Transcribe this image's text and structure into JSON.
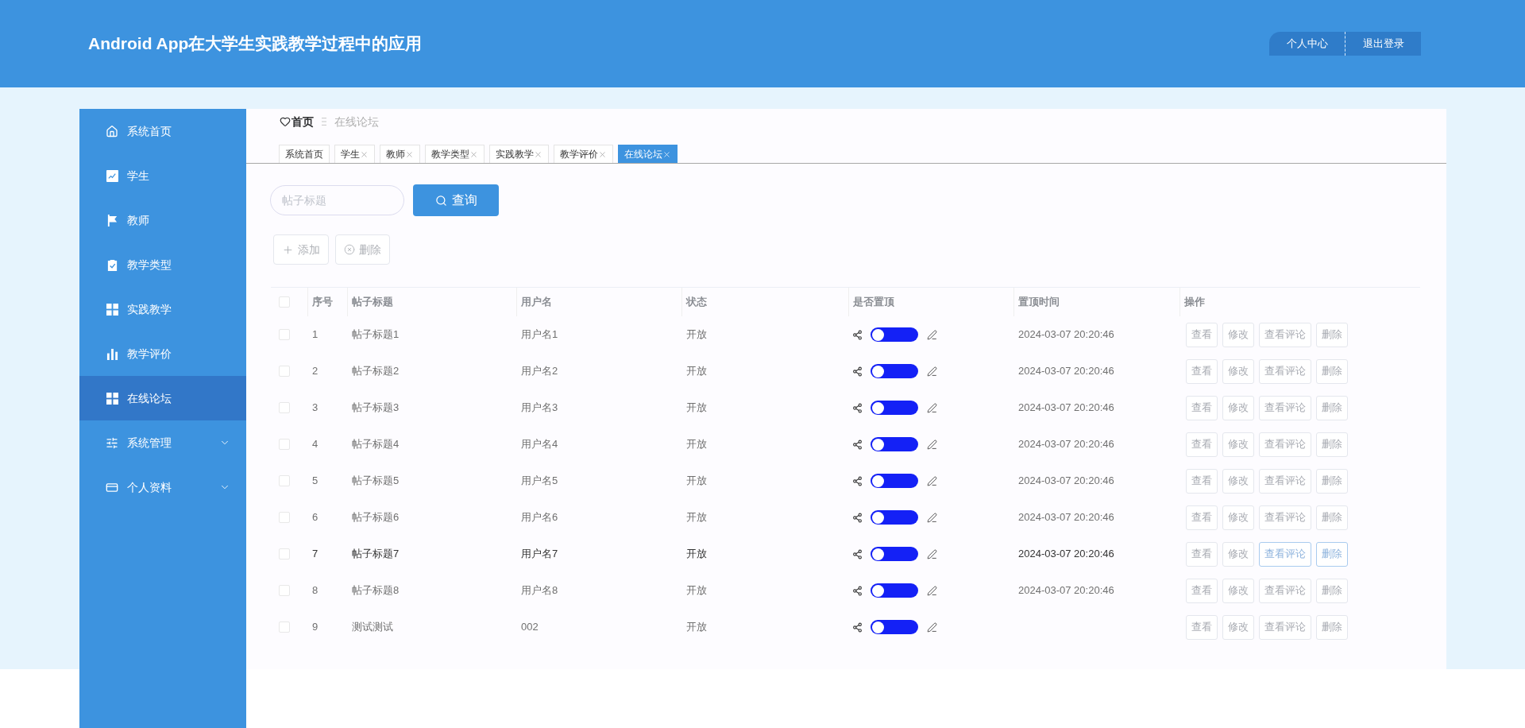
{
  "header": {
    "title": "Android App在大学生实践教学过程中的应用",
    "buttons": [
      "个人中心",
      "退出登录"
    ]
  },
  "sidebar": {
    "items": [
      {
        "label": "系统首页",
        "selected": false,
        "expandable": false
      },
      {
        "label": "学生",
        "selected": false,
        "expandable": false
      },
      {
        "label": "教师",
        "selected": false,
        "expandable": false
      },
      {
        "label": "教学类型",
        "selected": false,
        "expandable": false
      },
      {
        "label": "实践教学",
        "selected": false,
        "expandable": false
      },
      {
        "label": "教学评价",
        "selected": false,
        "expandable": false
      },
      {
        "label": "在线论坛",
        "selected": true,
        "expandable": false
      },
      {
        "label": "系统管理",
        "selected": false,
        "expandable": true
      },
      {
        "label": "个人资料",
        "selected": false,
        "expandable": true
      }
    ]
  },
  "breadcrumb": [
    "首页",
    "在线论坛"
  ],
  "tabs": [
    {
      "label": "系统首页",
      "selected": false,
      "closable": false
    },
    {
      "label": "学生",
      "selected": false,
      "closable": true
    },
    {
      "label": "教师",
      "selected": false,
      "closable": true
    },
    {
      "label": "教学类型",
      "selected": false,
      "closable": true
    },
    {
      "label": "实践教学",
      "selected": false,
      "closable": true
    },
    {
      "label": "教学评价",
      "selected": false,
      "closable": true
    },
    {
      "label": "在线论坛",
      "selected": true,
      "closable": true
    }
  ],
  "search": {
    "placeholder": "帖子标题",
    "button": "查询"
  },
  "toolbar": [
    {
      "label": "添加",
      "kind": "add"
    },
    {
      "label": "删除",
      "kind": "delete"
    }
  ],
  "table": {
    "all_checked": false,
    "columns": [
      "序号",
      "帖子标题",
      "用户名",
      "状态",
      "是否置顶",
      "置顶时间",
      "操作"
    ],
    "rows": [
      {
        "checked": false,
        "hovered": false,
        "cells": [
          "1",
          "帖子标题1",
          "用户名1",
          "开放"
        ],
        "pinned": false,
        "time": "2024-03-07 20:20:46",
        "actions": [
          {
            "label": "查看",
            "highlighted": false
          },
          {
            "label": "修改",
            "highlighted": false
          },
          {
            "label": "查看评论",
            "highlighted": false
          },
          {
            "label": "删除",
            "highlighted": false
          }
        ]
      },
      {
        "checked": false,
        "hovered": false,
        "cells": [
          "2",
          "帖子标题2",
          "用户名2",
          "开放"
        ],
        "pinned": false,
        "time": "2024-03-07 20:20:46",
        "actions": [
          {
            "label": "查看",
            "highlighted": false
          },
          {
            "label": "修改",
            "highlighted": false
          },
          {
            "label": "查看评论",
            "highlighted": false
          },
          {
            "label": "删除",
            "highlighted": false
          }
        ]
      },
      {
        "checked": false,
        "hovered": false,
        "cells": [
          "3",
          "帖子标题3",
          "用户名3",
          "开放"
        ],
        "pinned": false,
        "time": "2024-03-07 20:20:46",
        "actions": [
          {
            "label": "查看",
            "highlighted": false
          },
          {
            "label": "修改",
            "highlighted": false
          },
          {
            "label": "查看评论",
            "highlighted": false
          },
          {
            "label": "删除",
            "highlighted": false
          }
        ]
      },
      {
        "checked": false,
        "hovered": false,
        "cells": [
          "4",
          "帖子标题4",
          "用户名4",
          "开放"
        ],
        "pinned": false,
        "time": "2024-03-07 20:20:46",
        "actions": [
          {
            "label": "查看",
            "highlighted": false
          },
          {
            "label": "修改",
            "highlighted": false
          },
          {
            "label": "查看评论",
            "highlighted": false
          },
          {
            "label": "删除",
            "highlighted": false
          }
        ]
      },
      {
        "checked": false,
        "hovered": false,
        "cells": [
          "5",
          "帖子标题5",
          "用户名5",
          "开放"
        ],
        "pinned": false,
        "time": "2024-03-07 20:20:46",
        "actions": [
          {
            "label": "查看",
            "highlighted": false
          },
          {
            "label": "修改",
            "highlighted": false
          },
          {
            "label": "查看评论",
            "highlighted": false
          },
          {
            "label": "删除",
            "highlighted": false
          }
        ]
      },
      {
        "checked": false,
        "hovered": false,
        "cells": [
          "6",
          "帖子标题6",
          "用户名6",
          "开放"
        ],
        "pinned": false,
        "time": "2024-03-07 20:20:46",
        "actions": [
          {
            "label": "查看",
            "highlighted": false
          },
          {
            "label": "修改",
            "highlighted": false
          },
          {
            "label": "查看评论",
            "highlighted": false
          },
          {
            "label": "删除",
            "highlighted": false
          }
        ]
      },
      {
        "checked": false,
        "hovered": true,
        "cells": [
          "7",
          "帖子标题7",
          "用户名7",
          "开放"
        ],
        "pinned": false,
        "time": "2024-03-07 20:20:46",
        "actions": [
          {
            "label": "查看",
            "highlighted": false
          },
          {
            "label": "修改",
            "highlighted": false
          },
          {
            "label": "查看评论",
            "highlighted": true
          },
          {
            "label": "删除",
            "highlighted": true
          }
        ]
      },
      {
        "checked": false,
        "hovered": false,
        "cells": [
          "8",
          "帖子标题8",
          "用户名8",
          "开放"
        ],
        "pinned": false,
        "time": "2024-03-07 20:20:46",
        "actions": [
          {
            "label": "查看",
            "highlighted": false
          },
          {
            "label": "修改",
            "highlighted": false
          },
          {
            "label": "查看评论",
            "highlighted": false
          },
          {
            "label": "删除",
            "highlighted": false
          }
        ]
      },
      {
        "checked": false,
        "hovered": false,
        "cells": [
          "9",
          "测试测试",
          "002",
          "开放"
        ],
        "pinned": false,
        "actions": [
          {
            "label": "查看",
            "highlighted": false
          },
          {
            "label": "修改",
            "highlighted": false
          },
          {
            "label": "查看评论",
            "highlighted": false
          },
          {
            "label": "删除",
            "highlighted": false
          }
        ]
      }
    ]
  }
}
